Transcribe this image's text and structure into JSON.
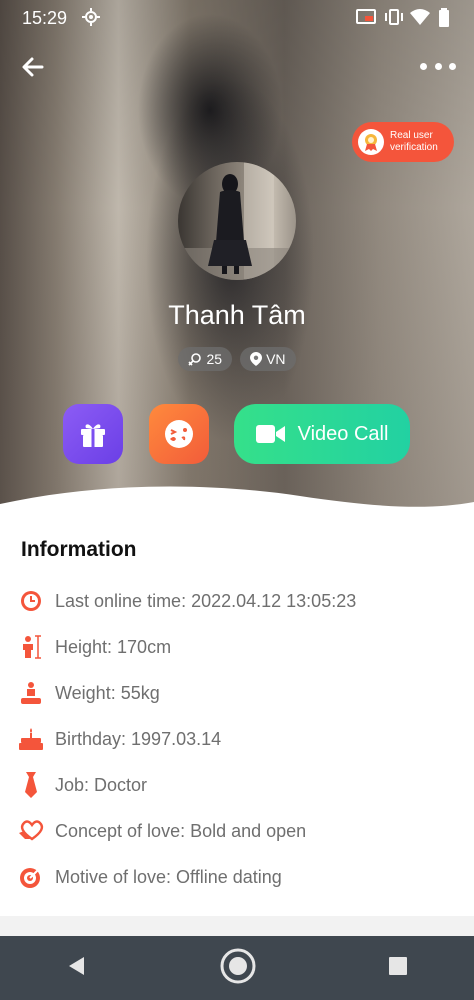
{
  "status_bar": {
    "time": "15:29"
  },
  "profile": {
    "name": "Thanh Tâm",
    "age": "25",
    "country": "VN",
    "verification_label": "Real user verification"
  },
  "actions": {
    "video_call_label": "Video Call"
  },
  "information": {
    "title": "Information",
    "items": [
      {
        "icon": "clock-icon",
        "text": "Last online time: 2022.04.12 13:05:23"
      },
      {
        "icon": "height-icon",
        "text": "Height: 170cm"
      },
      {
        "icon": "weight-icon",
        "text": "Weight: 55kg"
      },
      {
        "icon": "cake-icon",
        "text": "Birthday: 1997.03.14"
      },
      {
        "icon": "tie-icon",
        "text": "Job: Doctor"
      },
      {
        "icon": "heart-hand-icon",
        "text": "Concept of love: Bold and open"
      },
      {
        "icon": "target-icon",
        "text": "Motive of love: Offline dating"
      }
    ]
  },
  "colors": {
    "accent": "#f4553b",
    "gift_button": "#7b4ff0",
    "kiss_button": "#f77039",
    "video_button": "#2dd996",
    "nav_bar": "#3f474f"
  }
}
